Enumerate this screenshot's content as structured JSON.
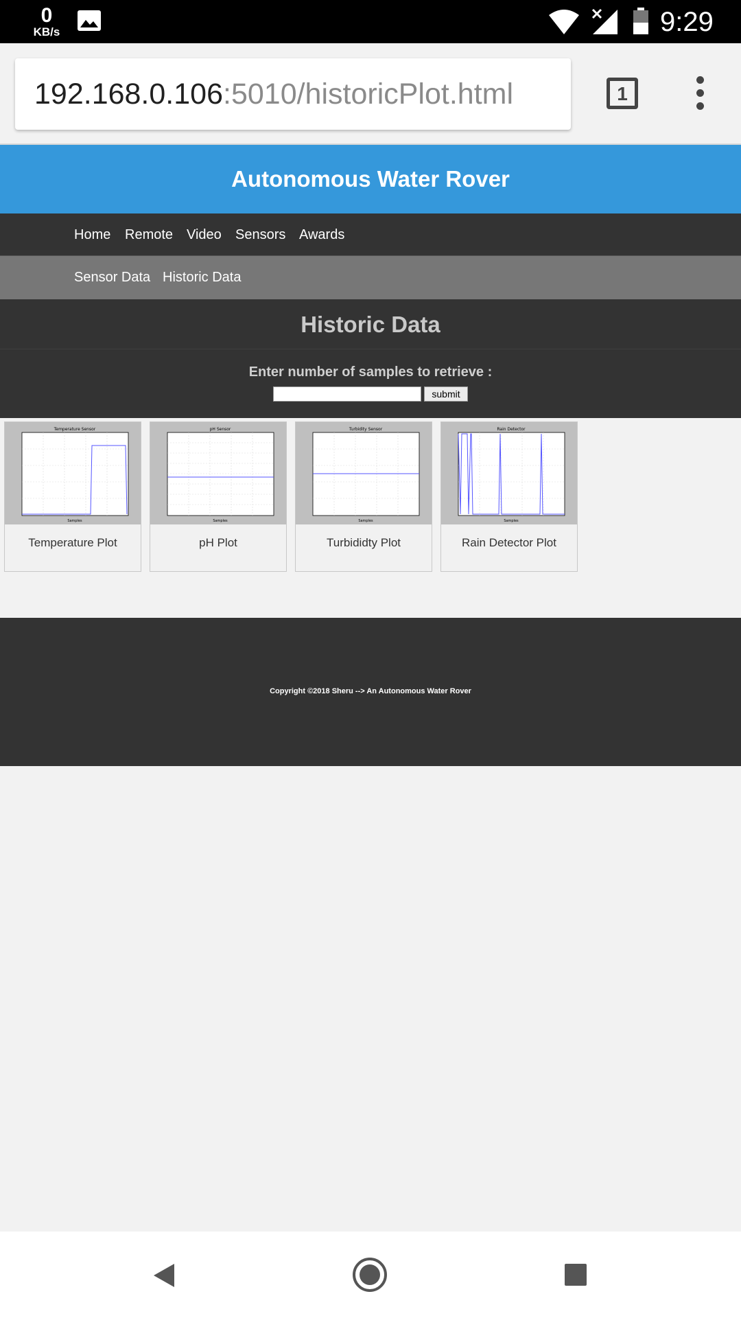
{
  "status_bar": {
    "net_speed": "0",
    "net_unit": "KB/s",
    "time": "9:29",
    "icons": [
      "image-icon",
      "wifi-icon",
      "signal-icon",
      "battery-icon"
    ]
  },
  "browser": {
    "url_host": "192.168.0.106",
    "url_path": ":5010/historicPlot.html",
    "tab_count": "1"
  },
  "site": {
    "title": "Autonomous Water Rover",
    "accent": "#3598db",
    "nav": [
      "Home",
      "Remote",
      "Video",
      "Sensors",
      "Awards"
    ],
    "subnav": [
      "Sensor Data",
      "Historic Data"
    ]
  },
  "main": {
    "section_title": "Historic Data",
    "form_label": "Enter number of samples to retrieve :",
    "input_value": "",
    "submit_label": "submit"
  },
  "plots": [
    {
      "caption": "Temperature Plot",
      "chart_title": "Temperature Sensor",
      "xlabel": "Samples"
    },
    {
      "caption": "pH Plot",
      "chart_title": "pH Sensor",
      "xlabel": "Samples"
    },
    {
      "caption": "Turbididty Plot",
      "chart_title": "Turbidity Sensor",
      "xlabel": "Samples"
    },
    {
      "caption": "Rain Detector Plot",
      "chart_title": "Rain Detector",
      "xlabel": "Samples"
    }
  ],
  "footer": {
    "text": "Copyright ©2018 Sheru --> An Autonomous Water Rover"
  }
}
